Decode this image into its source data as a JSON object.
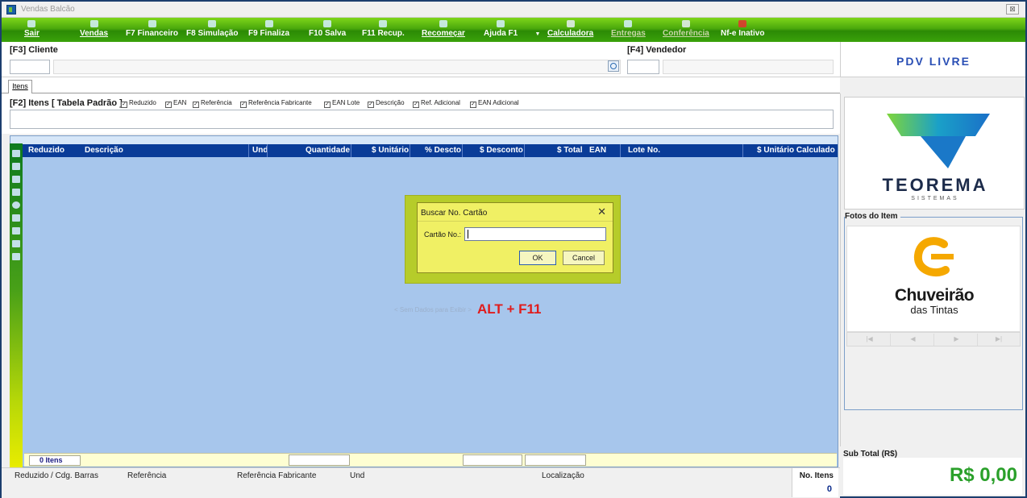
{
  "window": {
    "title": "Vendas Balcão",
    "close_label": "⊠"
  },
  "toolbar": {
    "items": [
      {
        "label": "Sair"
      },
      {
        "label": "Vendas"
      },
      {
        "label": "F7 Financeiro"
      },
      {
        "label": "F8 Simulação"
      },
      {
        "label": "F9 Finaliza"
      },
      {
        "label": "F10 Salva"
      },
      {
        "label": "F11 Recup."
      },
      {
        "label": "Recomeçar"
      },
      {
        "label": "Ajuda F1"
      },
      {
        "label": "Calculadora"
      },
      {
        "label": "Entregas"
      },
      {
        "label": "Conferência"
      },
      {
        "label": "Nf-e Inativo"
      }
    ],
    "dropdown_glyph": "▼"
  },
  "cliente": {
    "label": "[F3] Cliente",
    "code_value": "",
    "name_value": ""
  },
  "vendedor": {
    "label": "[F4] Vendedor",
    "code_value": "",
    "name_value": ""
  },
  "brand": {
    "pdv": "PDV LIVRE"
  },
  "tabs": [
    {
      "label": "Itens"
    }
  ],
  "items_panel": {
    "header": "[F2] Itens [ Tabela Padrão ]",
    "checkboxes": [
      {
        "label": "Reduzido",
        "checked": true
      },
      {
        "label": "EAN",
        "checked": true
      },
      {
        "label": "Referência",
        "checked": true
      },
      {
        "label": "Referência Fabricante",
        "checked": true
      },
      {
        "label": "EAN Lote",
        "checked": true
      },
      {
        "label": "Descrição",
        "checked": true
      },
      {
        "label": "Ref. Adicional",
        "checked": true
      },
      {
        "label": "EAN Adicional",
        "checked": true
      }
    ],
    "search_value": ""
  },
  "grid": {
    "columns": [
      "Reduzido",
      "Descrição",
      "Und",
      "Quantidade",
      "$ Unitário",
      "% Descto",
      "$ Desconto",
      "$ Total",
      "EAN",
      "Lote No.",
      "$ Unitário Calculado"
    ],
    "empty_text": "< Sem Dados para Exibir >",
    "hint": "ALT + F11",
    "footer_count": "0 Itens"
  },
  "bottom": {
    "labels": [
      "Reduzido / Cdg. Barras",
      "Referência",
      "Referência Fabricante",
      "Und",
      "Localização"
    ],
    "no_itens_label": "No. Itens",
    "no_itens_value": "0"
  },
  "right": {
    "logo_name": "TEOREMA",
    "logo_sub": "SISTEMAS",
    "fotos_label": "Fotos do Item",
    "photo_brand": "Chuveirão",
    "photo_brand_sub": "das Tintas",
    "nav": [
      "|◀",
      "◀",
      "▶",
      "▶|"
    ],
    "subtotal_label": "Sub Total (R$)",
    "subtotal_value": "R$ 0,00"
  },
  "dialog": {
    "title": "Buscar No. Cartão",
    "close": "✕",
    "field_label": "Cartão No.:",
    "field_value": "",
    "ok": "OK",
    "cancel": "Cancel"
  },
  "colors": {
    "toolbar_green": "#3aa20a",
    "grid_bg": "#a7c6ec",
    "grid_header": "#0a3c98",
    "hint_red": "#e01c1c",
    "subtotal_green": "#2aa02a",
    "dialog_yellow": "#f0f064"
  }
}
